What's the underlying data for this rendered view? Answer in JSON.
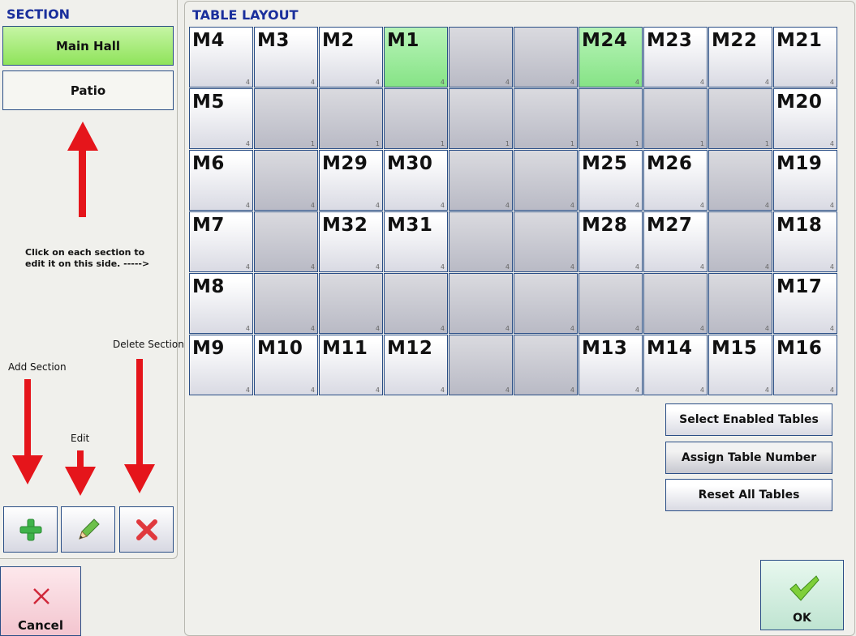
{
  "section": {
    "header": "SECTION",
    "items": [
      {
        "label": "Main Hall",
        "active": true
      },
      {
        "label": "Patio",
        "active": false
      }
    ]
  },
  "layout": {
    "header": "TABLE LAYOUT",
    "tiles": [
      {
        "name": "M4",
        "seats": "4",
        "state": "named"
      },
      {
        "name": "M3",
        "seats": "4",
        "state": "named"
      },
      {
        "name": "M2",
        "seats": "4",
        "state": "named"
      },
      {
        "name": "M1",
        "seats": "4",
        "state": "green"
      },
      {
        "name": "",
        "seats": "4",
        "state": "empty"
      },
      {
        "name": "",
        "seats": "4",
        "state": "empty"
      },
      {
        "name": "M24",
        "seats": "4",
        "state": "green"
      },
      {
        "name": "M23",
        "seats": "4",
        "state": "named"
      },
      {
        "name": "M22",
        "seats": "4",
        "state": "named"
      },
      {
        "name": "M21",
        "seats": "4",
        "state": "named"
      },
      {
        "name": "M5",
        "seats": "4",
        "state": "named"
      },
      {
        "name": "",
        "seats": "1",
        "state": "empty"
      },
      {
        "name": "",
        "seats": "1",
        "state": "empty"
      },
      {
        "name": "",
        "seats": "1",
        "state": "empty"
      },
      {
        "name": "",
        "seats": "1",
        "state": "empty"
      },
      {
        "name": "",
        "seats": "1",
        "state": "empty"
      },
      {
        "name": "",
        "seats": "1",
        "state": "empty"
      },
      {
        "name": "",
        "seats": "1",
        "state": "empty"
      },
      {
        "name": "",
        "seats": "1",
        "state": "empty"
      },
      {
        "name": "M20",
        "seats": "4",
        "state": "named"
      },
      {
        "name": "M6",
        "seats": "4",
        "state": "named"
      },
      {
        "name": "",
        "seats": "4",
        "state": "empty"
      },
      {
        "name": "M29",
        "seats": "4",
        "state": "named"
      },
      {
        "name": "M30",
        "seats": "4",
        "state": "named"
      },
      {
        "name": "",
        "seats": "4",
        "state": "empty"
      },
      {
        "name": "",
        "seats": "4",
        "state": "empty"
      },
      {
        "name": "M25",
        "seats": "4",
        "state": "named"
      },
      {
        "name": "M26",
        "seats": "4",
        "state": "named"
      },
      {
        "name": "",
        "seats": "4",
        "state": "empty"
      },
      {
        "name": "M19",
        "seats": "4",
        "state": "named"
      },
      {
        "name": "M7",
        "seats": "4",
        "state": "named"
      },
      {
        "name": "",
        "seats": "4",
        "state": "empty"
      },
      {
        "name": "M32",
        "seats": "4",
        "state": "named"
      },
      {
        "name": "M31",
        "seats": "4",
        "state": "named"
      },
      {
        "name": "",
        "seats": "4",
        "state": "empty"
      },
      {
        "name": "",
        "seats": "4",
        "state": "empty"
      },
      {
        "name": "M28",
        "seats": "4",
        "state": "named"
      },
      {
        "name": "M27",
        "seats": "4",
        "state": "named"
      },
      {
        "name": "",
        "seats": "4",
        "state": "empty"
      },
      {
        "name": "M18",
        "seats": "4",
        "state": "named"
      },
      {
        "name": "M8",
        "seats": "4",
        "state": "named"
      },
      {
        "name": "",
        "seats": "4",
        "state": "empty"
      },
      {
        "name": "",
        "seats": "4",
        "state": "empty"
      },
      {
        "name": "",
        "seats": "4",
        "state": "empty"
      },
      {
        "name": "",
        "seats": "4",
        "state": "empty"
      },
      {
        "name": "",
        "seats": "4",
        "state": "empty"
      },
      {
        "name": "",
        "seats": "4",
        "state": "empty"
      },
      {
        "name": "",
        "seats": "4",
        "state": "empty"
      },
      {
        "name": "",
        "seats": "4",
        "state": "empty"
      },
      {
        "name": "M17",
        "seats": "4",
        "state": "named"
      },
      {
        "name": "M9",
        "seats": "4",
        "state": "named"
      },
      {
        "name": "M10",
        "seats": "4",
        "state": "named"
      },
      {
        "name": "M11",
        "seats": "4",
        "state": "named"
      },
      {
        "name": "M12",
        "seats": "4",
        "state": "named"
      },
      {
        "name": "",
        "seats": "4",
        "state": "empty"
      },
      {
        "name": "",
        "seats": "4",
        "state": "empty"
      },
      {
        "name": "M13",
        "seats": "4",
        "state": "named"
      },
      {
        "name": "M14",
        "seats": "4",
        "state": "named"
      },
      {
        "name": "M15",
        "seats": "4",
        "state": "named"
      },
      {
        "name": "M16",
        "seats": "4",
        "state": "named"
      }
    ]
  },
  "actions": {
    "select_enabled": "Select Enabled Tables",
    "assign_number": "Assign Table Number",
    "reset_all": "Reset All Tables"
  },
  "annotations": {
    "click_hint_line1": "Click on each section to",
    "click_hint_line2": "edit it on this side. ----->",
    "add_section": "Add Section",
    "edit": "Edit",
    "delete_section": "Delete Section"
  },
  "tools": {
    "add_icon": "plus-icon",
    "edit_icon": "pencil-icon",
    "delete_icon": "x-icon"
  },
  "footer": {
    "cancel_label": "Cancel",
    "ok_label": "OK"
  },
  "colors": {
    "header_blue": "#1a2f9c",
    "active_green": "#8fe35a",
    "arrow_red": "#e5151b"
  }
}
